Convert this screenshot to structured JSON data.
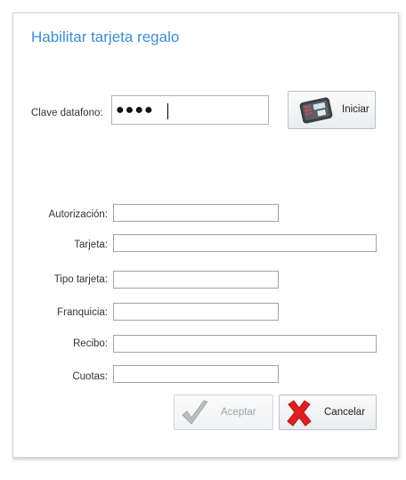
{
  "dialog": {
    "title": "Habilitar tarjeta regalo"
  },
  "pin": {
    "label": "Clave datafono:",
    "masked_value": "●●●●",
    "start_button": "Iniciar",
    "start_icon": "card-terminal-icon"
  },
  "fields": {
    "autorizacion": {
      "label": "Autorización:",
      "value": ""
    },
    "tarjeta": {
      "label": "Tarjeta:",
      "value": ""
    },
    "tipo_tarjeta": {
      "label": "Tipo tarjeta:",
      "value": ""
    },
    "franquicia": {
      "label": "Franquicia:",
      "value": ""
    },
    "recibo": {
      "label": "Recibo:",
      "value": ""
    },
    "cuotas": {
      "label": "Cuotas:",
      "value": ""
    }
  },
  "actions": {
    "accept_label": "Aceptar",
    "accept_icon": "checkmark-icon",
    "accept_enabled": false,
    "cancel_label": "Cancelar",
    "cancel_icon": "red-x-icon"
  },
  "colors": {
    "title": "#3a8ed3",
    "cancel_icon": "#e02020",
    "accept_icon": "#b9bec3"
  }
}
